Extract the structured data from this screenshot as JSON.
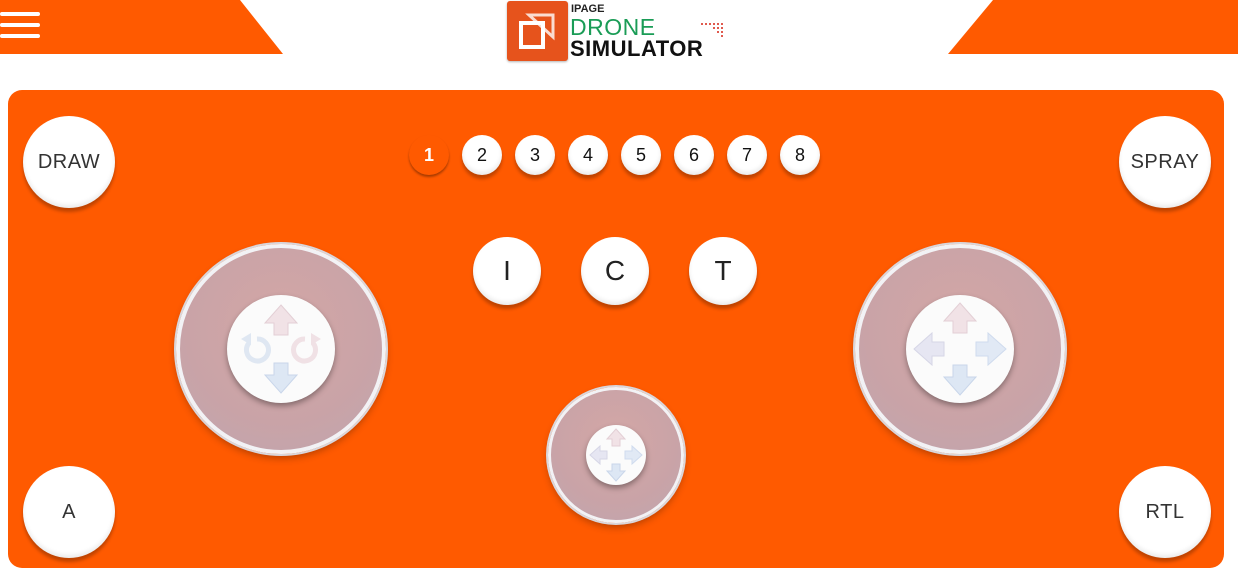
{
  "header": {
    "logo": {
      "ipage": "IPAGE",
      "line1": "DRONE",
      "line2": "SIMULATOR"
    },
    "menu_icon": "hamburger-menu-icon"
  },
  "controls": {
    "draw_label": "DRAW",
    "spray_label": "SPRAY",
    "a_label": "A",
    "rtl_label": "RTL"
  },
  "drone_selector": {
    "numbers": [
      "1",
      "2",
      "3",
      "4",
      "5",
      "6",
      "7",
      "8"
    ],
    "selected": "1"
  },
  "modes": [
    "I",
    "C",
    "T"
  ],
  "colors": {
    "accent": "#ff5a00",
    "logo_green": "#1a9c56",
    "logo_box": "#e6531c"
  }
}
